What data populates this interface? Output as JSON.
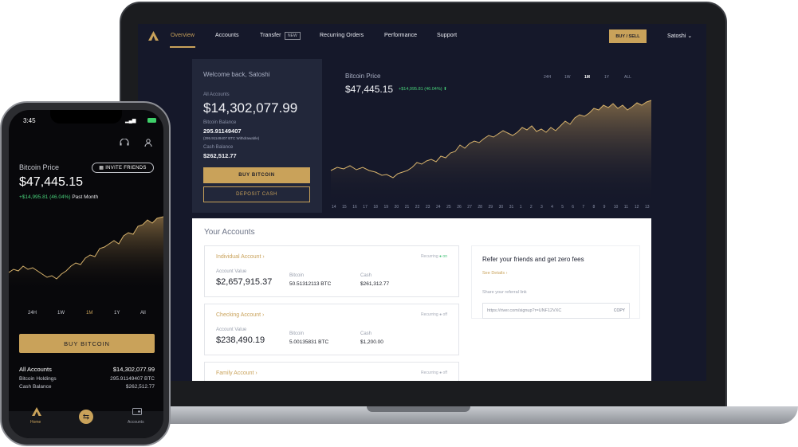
{
  "colors": {
    "accent": "#c9a25a",
    "positive": "#48d17a",
    "dark_bg": "#15182a",
    "card_bg": "#22273a"
  },
  "desktop": {
    "nav": {
      "items": [
        "Overview",
        "Accounts",
        "Transfer",
        "Recurring Orders",
        "Performance",
        "Support"
      ],
      "new_badge": "NEW",
      "buy_sell": "BUY / SELL",
      "user": "Satoshi"
    },
    "balance": {
      "welcome": "Welcome back, Satoshi",
      "all_accounts_label": "All Accounts",
      "all_accounts_value": "$14,302,077.99",
      "btc_label": "Bitcoin Balance",
      "btc_value": "295.91149407",
      "btc_withdrawable": "(295.91149407 BTC Withdrawable)",
      "cash_label": "Cash Balance",
      "cash_value": "$262,512.77",
      "buy_button": "BUY BITCOIN",
      "deposit_button": "DEPOSIT CASH"
    },
    "price": {
      "title": "Bitcoin Price",
      "value": "$47,445.15",
      "change": "+$14,995.81 (46.04%) ⬆",
      "ranges": [
        "24H",
        "1W",
        "1M",
        "1Y",
        "ALL"
      ],
      "active_range": "1M",
      "x_ticks": [
        "14",
        "15",
        "16",
        "17",
        "18",
        "19",
        "20",
        "21",
        "22",
        "23",
        "24",
        "25",
        "26",
        "27",
        "28",
        "29",
        "30",
        "31",
        "1",
        "2",
        "3",
        "4",
        "5",
        "6",
        "7",
        "8",
        "9",
        "10",
        "11",
        "12",
        "13"
      ]
    },
    "accounts": {
      "title": "Your Accounts",
      "cards": [
        {
          "name": "Individual Account ›",
          "recurring": "Recurring",
          "state": "● on",
          "value_label": "Account Value",
          "value": "$2,657,915.37",
          "btc_label": "Bitcoin",
          "btc": "50.51312113 BTC",
          "cash_label": "Cash",
          "cash": "$261,312.77"
        },
        {
          "name": "Checking Account ›",
          "recurring": "Recurring",
          "state": "● off",
          "value_label": "Account Value",
          "value": "$238,490.19",
          "btc_label": "Bitcoin",
          "btc": "5.00135831 BTC",
          "cash_label": "Cash",
          "cash": "$1,200.00"
        },
        {
          "name": "Family Account ›",
          "recurring": "Recurring",
          "state": "● off"
        }
      ],
      "referral": {
        "heading": "Refer your friends and get zero fees",
        "see_details": "See Details ›",
        "share_label": "Share your referral link",
        "link": "https://river.com/signup?r=UNF12VXC",
        "copy": "COPY"
      }
    }
  },
  "phone": {
    "time": "3:45",
    "title": "Bitcoin Price",
    "invite": "INVITE FRIENDS",
    "price": "$47,445.15",
    "change": "+$14,995.81 (46.04%)",
    "period": "Past Month",
    "ranges": [
      "24H",
      "1W",
      "1M",
      "1Y",
      "All"
    ],
    "active_range": "1M",
    "buy": "BUY BITCOIN",
    "summary": [
      {
        "label": "All Accounts",
        "value": "$14,302,077.99"
      },
      {
        "label": "Bitcoin Holdings",
        "value": "295.91149407 BTC"
      },
      {
        "label": "Cash Balance",
        "value": "$262,512.77"
      }
    ],
    "tabs": [
      "Home",
      "Accounts"
    ]
  }
}
